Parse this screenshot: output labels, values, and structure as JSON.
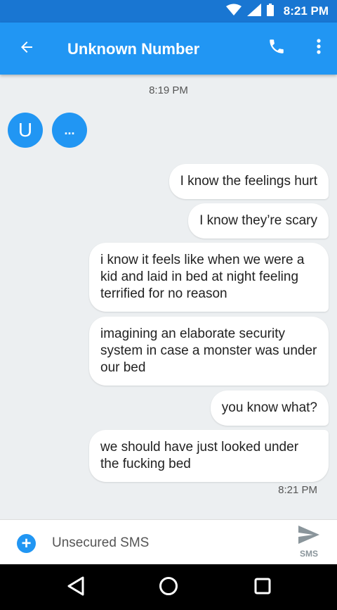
{
  "status_bar": {
    "time": "8:21 PM",
    "icons": [
      "wifi-icon",
      "cell-signal-icon",
      "battery-icon"
    ]
  },
  "app_bar": {
    "title": "Unknown Number",
    "icons": [
      "back-arrow-icon",
      "phone-icon",
      "more-vert-icon"
    ]
  },
  "thread": {
    "top_timestamp": "8:19 PM",
    "contact_avatar": {
      "initial": "U"
    },
    "typing_indicator": "...",
    "messages": [
      {
        "text": "I know the feelings hurt"
      },
      {
        "text": "I know they’re scary"
      },
      {
        "text": "i know it feels like when we were a kid and laid in bed at night feeling terrified for no reason"
      },
      {
        "text": "imagining an elaborate security system in case a monster was under our bed"
      },
      {
        "text": "you know what?"
      },
      {
        "text": "we should have just looked under the fucking bed"
      }
    ],
    "bottom_timestamp": "8:21 PM"
  },
  "compose": {
    "placeholder": "Unsecured SMS",
    "value": "",
    "add_label": "+",
    "send_label": "SMS"
  },
  "colors": {
    "primary": "#2196f3",
    "primary_dark": "#1976d2",
    "background": "#eceff1"
  }
}
